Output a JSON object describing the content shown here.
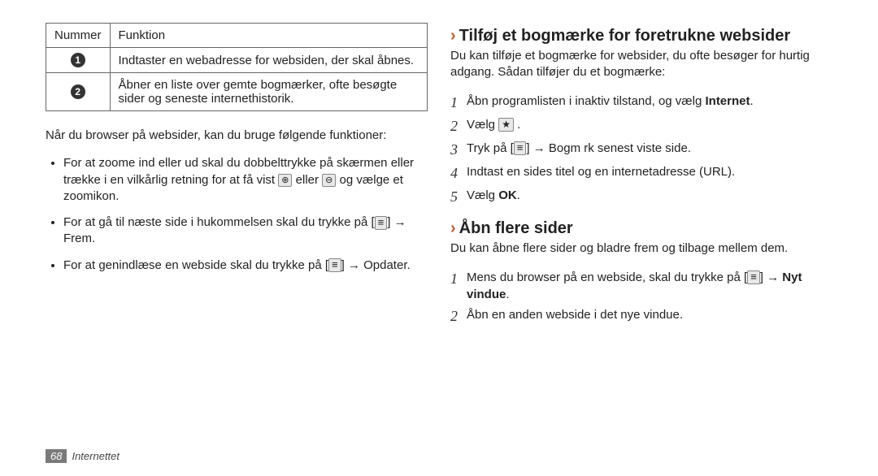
{
  "table": {
    "headers": {
      "num": "Nummer",
      "func": "Funktion"
    },
    "rows": [
      {
        "n": "1",
        "text": "Indtaster en webadresse for websiden, der skal åbnes."
      },
      {
        "n": "2",
        "text": "Åbner en liste over gemte bogmærker, ofte besøgte sider og seneste internethistorik."
      }
    ]
  },
  "intro_functions": "Når du browser på websider, kan du bruge følgende funktioner:",
  "bullets": [
    {
      "pre": "For at zoome ind eller ud skal du dobbelttrykke på skærmen eller trække i en vilkårlig retning for at få vist ",
      "mid": " eller ",
      "post": " og vælge et zoomikon."
    },
    {
      "pre": "For at gå til næste side i hukommelsen skal du trykke på [",
      "post": "] → Frem."
    },
    {
      "pre": "For at genindlæse en webside skal du trykke på [",
      "post": "] → Opdater."
    }
  ],
  "section_bookmark": {
    "title": "Tilføj et bogmærke for foretrukne websider",
    "desc": "Du kan tilføje et bogmærke for websider, du ofte besøger for hurtig adgang. Sådan tilføjer du et bogmærke:",
    "steps": [
      {
        "n": "1",
        "pre": "Åbn programlisten i inaktiv tilstand, og vælg ",
        "bold": "Internet",
        "post": "."
      },
      {
        "n": "2",
        "pre": "Vælg ",
        "icon": "star",
        "post": " ."
      },
      {
        "n": "3",
        "pre": "Tryk på [",
        "icon": "menu",
        "post": "] → Bogm rk senest viste side."
      },
      {
        "n": "4",
        "text": "Indtast en sides titel og en internetadresse (URL)."
      },
      {
        "n": "5",
        "pre": "Vælg ",
        "bold": "OK",
        "post": "."
      }
    ]
  },
  "section_pages": {
    "title": "Åbn flere sider",
    "desc": "Du kan åbne flere sider og bladre frem og tilbage mellem dem.",
    "steps": [
      {
        "n": "1",
        "pre": "Mens du browser på en webside, skal du trykke på [",
        "icon": "menu",
        "post": "] → Nyt vindue.",
        "bold_post": "Nyt vindue"
      },
      {
        "n": "2",
        "text": "Åbn en anden webside i det nye vindue."
      }
    ]
  },
  "footer": {
    "page": "68",
    "section": "Internettet"
  }
}
